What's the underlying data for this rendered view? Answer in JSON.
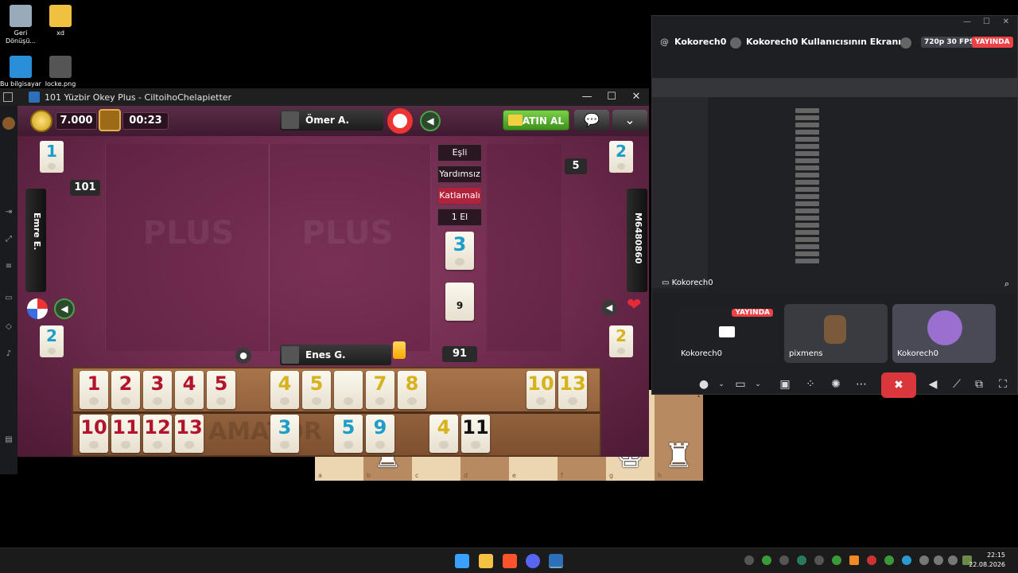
{
  "desktop": {
    "icons": [
      {
        "label": "Geri Dönüşü..."
      },
      {
        "label": "xd"
      },
      {
        "label": "Bu bilgisayar"
      },
      {
        "label": "locke.png"
      }
    ]
  },
  "game_window": {
    "title": "101 Yüzbir Okey Plus - CiltoihoChelapietter",
    "controls": [
      "—",
      "☐",
      "✕"
    ],
    "chips": "7.000",
    "timer": "00:23",
    "top_player": "Ömer A.",
    "bottom_player": "Enes G.",
    "left_player": "Emre E.",
    "right_player": "M6480860",
    "buy_label": "SATIN AL",
    "chat_glyph": "💬",
    "menu_glyph": "⌄",
    "menu_items": [
      "Eşli",
      "Yardımsız",
      "Katlamalı",
      "1 El"
    ],
    "active_menu": "Katlamalı",
    "left_indicator": "101",
    "right_indicator": "5",
    "deck_count": "91",
    "center_tile": "3",
    "deck_tile": "9",
    "corner_tiles": {
      "top_left": "1",
      "top_right": "2",
      "bottom_left": "2",
      "bottom_right": "2"
    },
    "plus_label": "PLUS",
    "rack_watermark": "AMATÖR",
    "rack_top": [
      {
        "n": "1",
        "c": "red"
      },
      {
        "n": "2",
        "c": "red"
      },
      {
        "n": "3",
        "c": "red"
      },
      {
        "n": "4",
        "c": "red"
      },
      {
        "n": "5",
        "c": "red"
      },
      {
        "n": "4",
        "c": "yellow"
      },
      {
        "n": "5",
        "c": "yellow"
      },
      {
        "n": "",
        "c": "blank"
      },
      {
        "n": "7",
        "c": "yellow"
      },
      {
        "n": "8",
        "c": "yellow"
      },
      {
        "n": "10",
        "c": "yellow"
      },
      {
        "n": "13",
        "c": "yellow"
      }
    ],
    "rack_bottom": [
      {
        "n": "10",
        "c": "red"
      },
      {
        "n": "11",
        "c": "red"
      },
      {
        "n": "12",
        "c": "red"
      },
      {
        "n": "13",
        "c": "red"
      },
      {
        "n": "3",
        "c": "blue"
      },
      {
        "n": "5",
        "c": "blue"
      },
      {
        "n": "9",
        "c": "blue"
      },
      {
        "n": "4",
        "c": "yellow"
      },
      {
        "n": "11",
        "c": "black"
      }
    ]
  },
  "chess": {
    "files": [
      "a",
      "b",
      "c",
      "d",
      "e",
      "f",
      "g",
      "h"
    ],
    "rank_label": "1"
  },
  "discord": {
    "user": "Kokorech0",
    "screen_title": "Kokorech0 Kullanıcısının Ekranı",
    "fps": "720p 30 FPS",
    "live": "YAYINDA",
    "stream_label": "Kokorech0",
    "participants": [
      {
        "name": "Kokorech0",
        "live": "YAYINDA"
      },
      {
        "name": "pixmens"
      },
      {
        "name": "Kokorech0"
      }
    ]
  },
  "taskbar": {
    "time": "22:15",
    "date": "22.08.2026"
  },
  "colors": {
    "tile_red": "#b3142b",
    "tile_blue": "#1e9dc9",
    "tile_yellow": "#d7b21c",
    "live_red": "#ed4245"
  }
}
